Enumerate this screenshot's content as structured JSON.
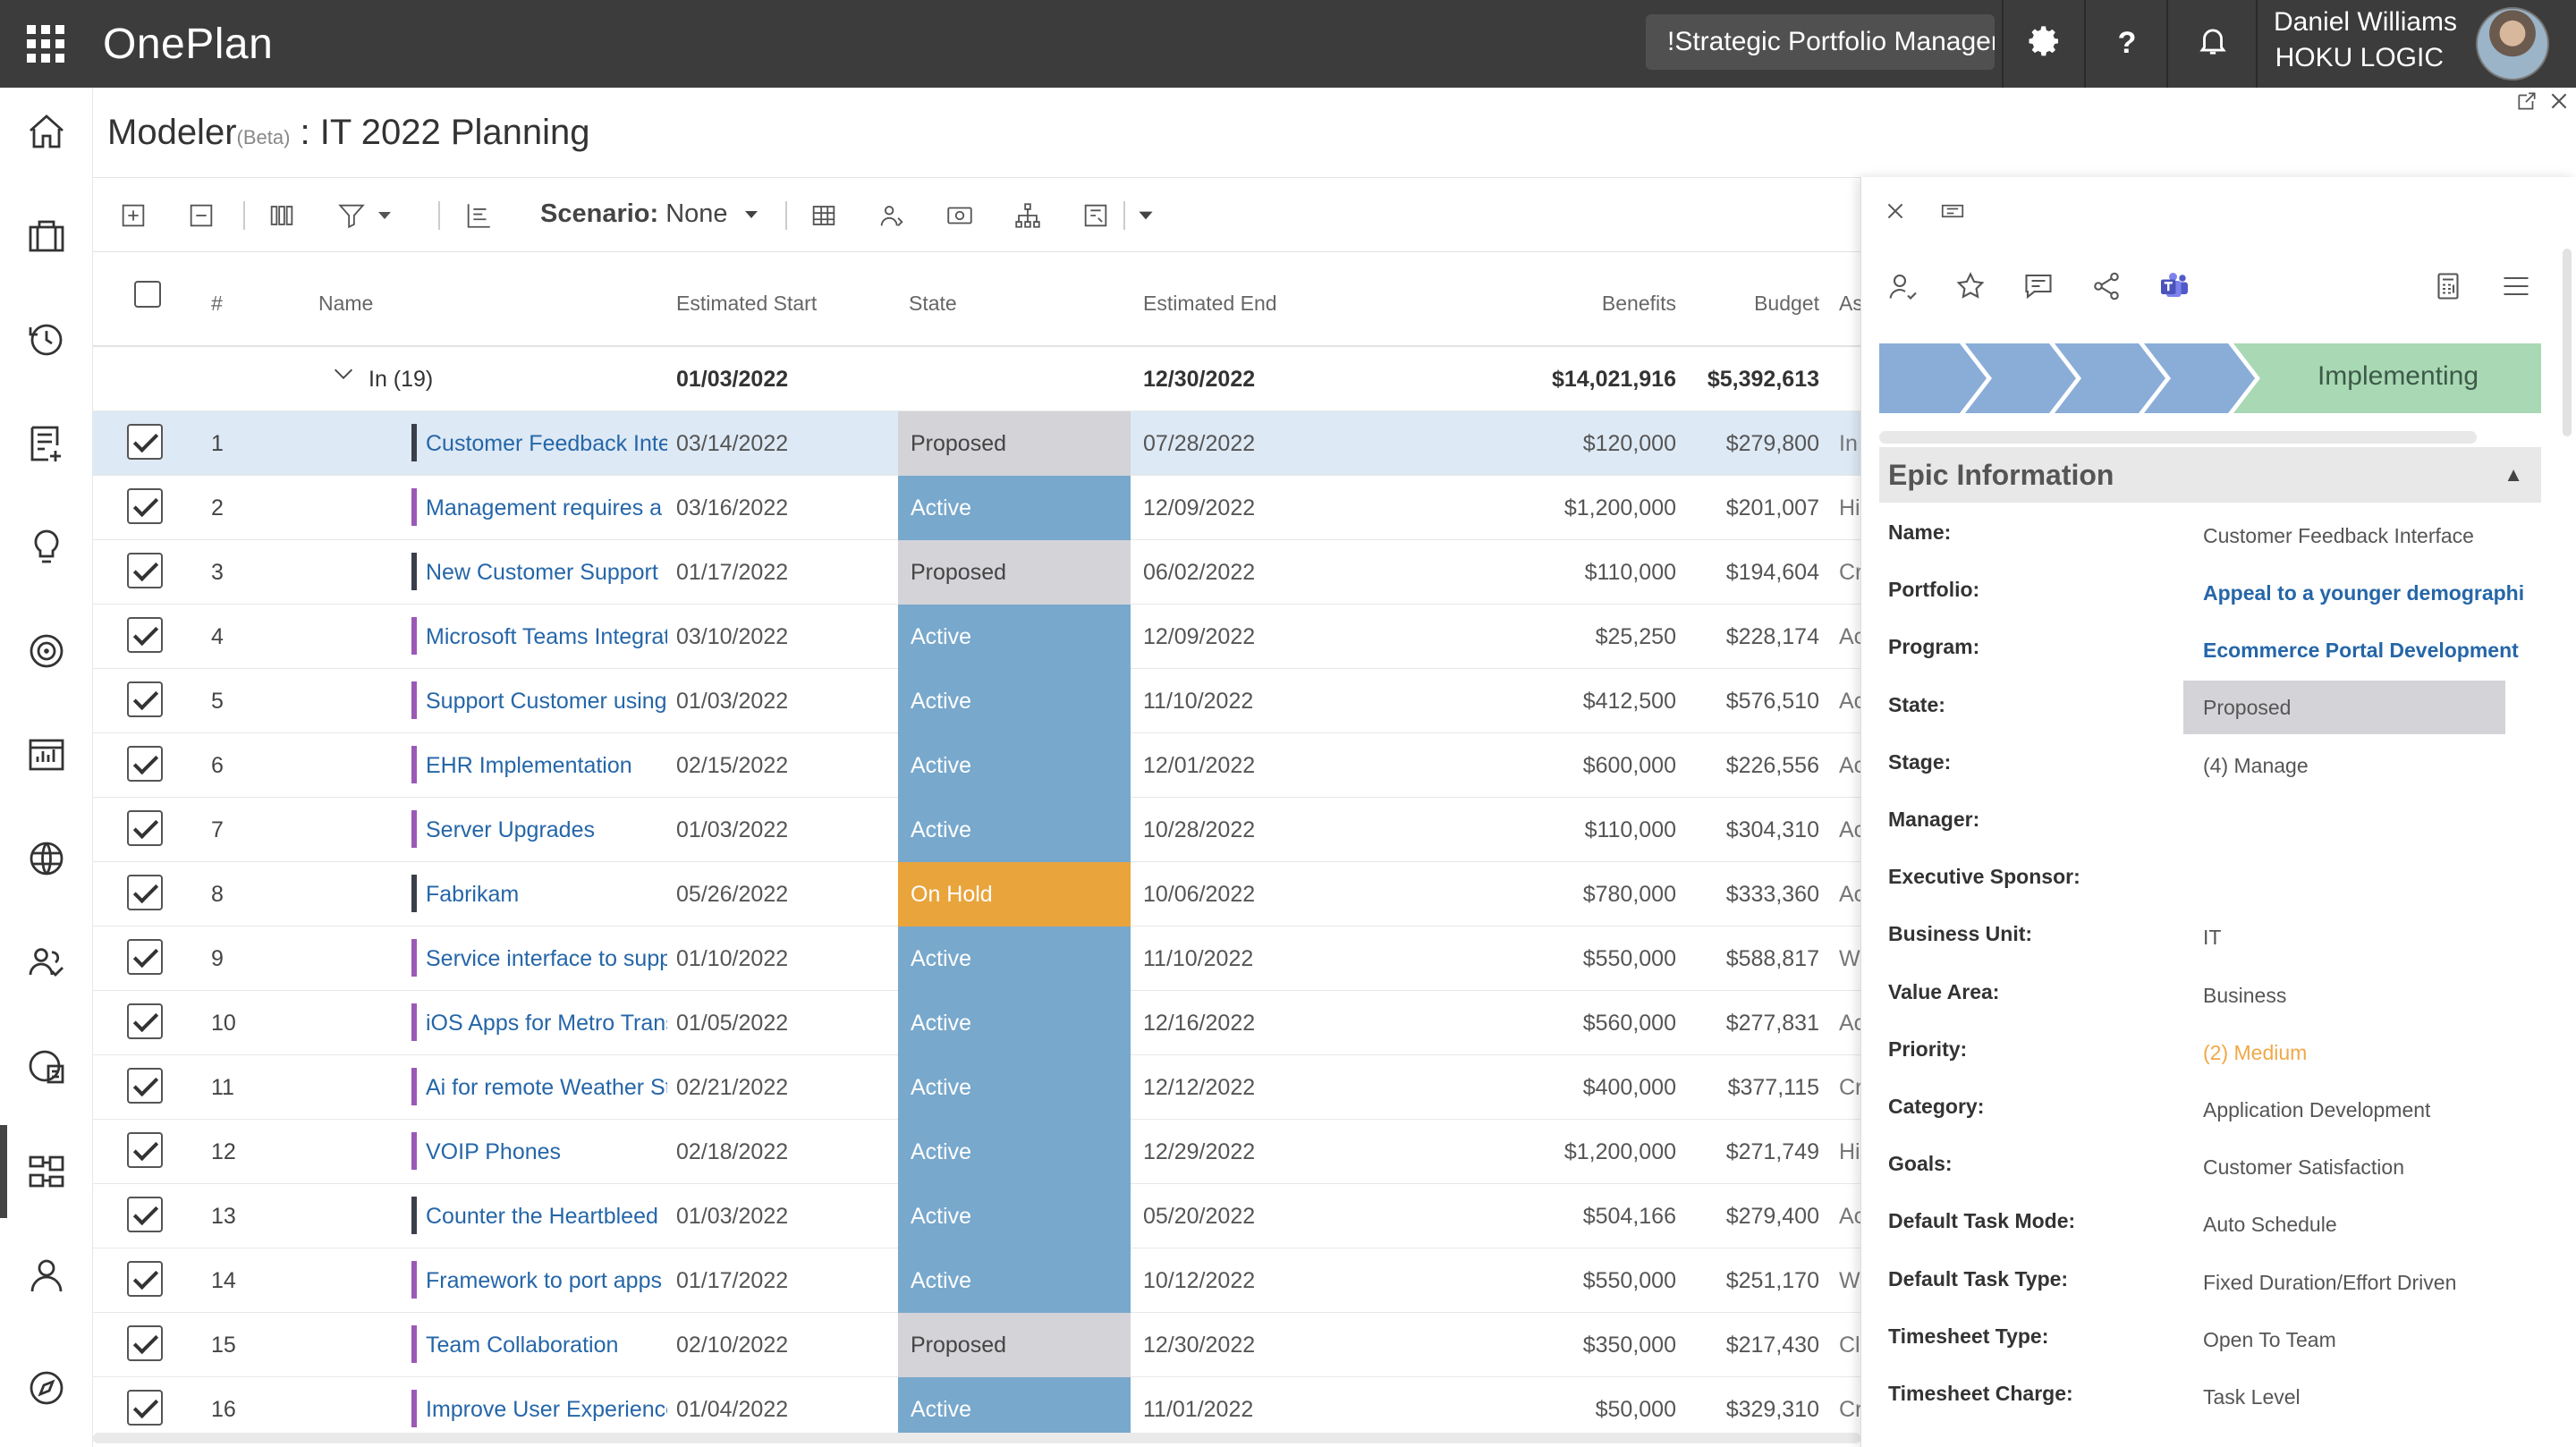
{
  "app": {
    "brand": "OnePlan",
    "role": "!Strategic Portfolio Manager",
    "user_name": "Daniel Williams",
    "user_org": "HOKU LOGIC"
  },
  "page": {
    "title_main": "Modeler",
    "title_beta": "(Beta)",
    "title_rest": " : IT 2022 Planning"
  },
  "toolbar": {
    "scenario_label": "Scenario:",
    "scenario_value": "None"
  },
  "grid": {
    "headers": {
      "num": "#",
      "name": "Name",
      "start": "Estimated Start",
      "state": "State",
      "end": "Estimated End",
      "benefits": "Benefits",
      "budget": "Budget",
      "extra": "As"
    },
    "group": {
      "label": "In (19)",
      "start": "01/03/2022",
      "end": "12/30/2022",
      "benefits": "$14,021,916",
      "budget": "$5,392,613"
    },
    "rows": [
      {
        "num": "1",
        "name": "Customer Feedback Interface",
        "start": "03/14/2022",
        "state": "Proposed",
        "end": "07/28/2022",
        "benefits": "$120,000",
        "budget": "$279,800",
        "extra": "In"
      },
      {
        "num": "2",
        "name": "Management requires a",
        "start": "03/16/2022",
        "state": "Active",
        "end": "12/09/2022",
        "benefits": "$1,200,000",
        "budget": "$201,007",
        "extra": "Hi"
      },
      {
        "num": "3",
        "name": "New Customer Support",
        "start": "01/17/2022",
        "state": "Proposed",
        "end": "06/02/2022",
        "benefits": "$110,000",
        "budget": "$194,604",
        "extra": "Cr"
      },
      {
        "num": "4",
        "name": "Microsoft Teams Integration",
        "start": "03/10/2022",
        "state": "Active",
        "end": "12/09/2022",
        "benefits": "$25,250",
        "budget": "$228,174",
        "extra": "Ac"
      },
      {
        "num": "5",
        "name": "Support Customer using",
        "start": "01/03/2022",
        "state": "Active",
        "end": "11/10/2022",
        "benefits": "$412,500",
        "budget": "$576,510",
        "extra": "Ac"
      },
      {
        "num": "6",
        "name": "EHR Implementation",
        "start": "02/15/2022",
        "state": "Active",
        "end": "12/01/2022",
        "benefits": "$600,000",
        "budget": "$226,556",
        "extra": "Ac"
      },
      {
        "num": "7",
        "name": "Server Upgrades",
        "start": "01/03/2022",
        "state": "Active",
        "end": "10/28/2022",
        "benefits": "$110,000",
        "budget": "$304,310",
        "extra": "Ac"
      },
      {
        "num": "8",
        "name": "Fabrikam",
        "start": "05/26/2022",
        "state": "On Hold",
        "end": "10/06/2022",
        "benefits": "$780,000",
        "budget": "$333,360",
        "extra": "Ac"
      },
      {
        "num": "9",
        "name": "Service interface to support",
        "start": "01/10/2022",
        "state": "Active",
        "end": "11/10/2022",
        "benefits": "$550,000",
        "budget": "$588,817",
        "extra": "W"
      },
      {
        "num": "10",
        "name": "iOS Apps for Metro Transit",
        "start": "01/05/2022",
        "state": "Active",
        "end": "12/16/2022",
        "benefits": "$560,000",
        "budget": "$277,831",
        "extra": "Ac"
      },
      {
        "num": "11",
        "name": "Ai for remote Weather Stations",
        "start": "02/21/2022",
        "state": "Active",
        "end": "12/12/2022",
        "benefits": "$400,000",
        "budget": "$377,115",
        "extra": "Cr"
      },
      {
        "num": "12",
        "name": "VOIP Phones",
        "start": "02/18/2022",
        "state": "Active",
        "end": "12/29/2022",
        "benefits": "$1,200,000",
        "budget": "$271,749",
        "extra": "Hi"
      },
      {
        "num": "13",
        "name": "Counter the Heartbleed",
        "start": "01/03/2022",
        "state": "Active",
        "end": "05/20/2022",
        "benefits": "$504,166",
        "budget": "$279,400",
        "extra": "Ac"
      },
      {
        "num": "14",
        "name": "Framework to port apps",
        "start": "01/17/2022",
        "state": "Active",
        "end": "10/12/2022",
        "benefits": "$550,000",
        "budget": "$251,170",
        "extra": "W"
      },
      {
        "num": "15",
        "name": "Team Collaboration",
        "start": "02/10/2022",
        "state": "Proposed",
        "end": "12/30/2022",
        "benefits": "$350,000",
        "budget": "$217,430",
        "extra": "Cl"
      },
      {
        "num": "16",
        "name": "Improve User Experience",
        "start": "01/04/2022",
        "state": "Active",
        "end": "11/01/2022",
        "benefits": "$50,000",
        "budget": "$329,310",
        "extra": "Cr"
      }
    ]
  },
  "state_colors": {
    "Proposed": "#d3d3d8",
    "Active": "#78a8cc",
    "On Hold": "#e9a43c"
  },
  "bar_colors": [
    "#3a3f4a",
    "#9b59b6",
    "#3a3f4a",
    "#9b59b6",
    "#9b59b6",
    "#9b59b6",
    "#9b59b6",
    "#3a3f4a",
    "#9b59b6",
    "#9b59b6",
    "#9b59b6",
    "#9b59b6",
    "#3a3f4a",
    "#9b59b6",
    "#9b59b6",
    "#9b59b6"
  ],
  "panel": {
    "stage_current": "Implementing",
    "section_title": "Epic Information",
    "fields": [
      {
        "label": "Name:",
        "value": "Customer Feedback Interface",
        "kind": "text"
      },
      {
        "label": "Portfolio:",
        "value": "Appeal to a younger demographic",
        "kind": "link"
      },
      {
        "label": "Program:",
        "value": "Ecommerce Portal Development",
        "kind": "link"
      },
      {
        "label": "State:",
        "value": "Proposed",
        "kind": "state"
      },
      {
        "label": "Stage:",
        "value": "(4) Manage",
        "kind": "text"
      },
      {
        "label": "Manager:",
        "value": "",
        "kind": "text"
      },
      {
        "label": "Executive Sponsor:",
        "value": "",
        "kind": "text"
      },
      {
        "label": "Business Unit:",
        "value": "IT",
        "kind": "text"
      },
      {
        "label": "Value Area:",
        "value": "Business",
        "kind": "text"
      },
      {
        "label": "Priority:",
        "value": "(2) Medium",
        "kind": "priority"
      },
      {
        "label": "Category:",
        "value": "Application Development",
        "kind": "text"
      },
      {
        "label": "Goals:",
        "value": "Customer Satisfaction",
        "kind": "text"
      },
      {
        "label": "Default Task Mode:",
        "value": "Auto Schedule",
        "kind": "text"
      },
      {
        "label": "Default Task Type:",
        "value": "Fixed Duration/Effort Driven",
        "kind": "text"
      },
      {
        "label": "Timesheet Type:",
        "value": "Open To Team",
        "kind": "text"
      },
      {
        "label": "Timesheet Charge:",
        "value": "Task Level",
        "kind": "text"
      }
    ]
  },
  "icons": [
    "waffle-icon",
    "gear-icon",
    "help-icon",
    "bell-icon",
    "home-icon",
    "briefcase-icon",
    "history-icon",
    "list-add-icon",
    "lightbulb-icon",
    "target-icon",
    "chart-icon",
    "globe-icon",
    "people-check-icon",
    "report-icon",
    "modeler-icon",
    "person-icon",
    "compass-icon"
  ]
}
